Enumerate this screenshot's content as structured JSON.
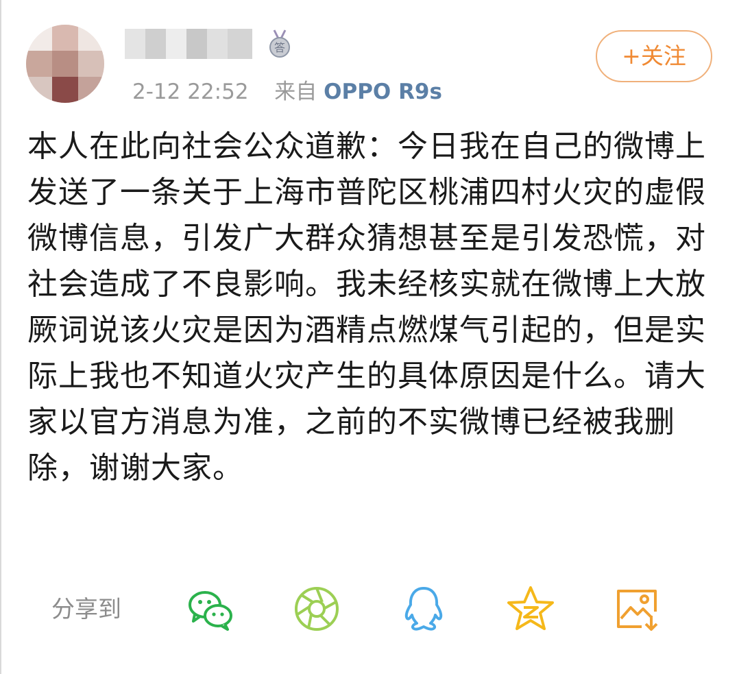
{
  "post": {
    "timestamp": "2-12 22:52",
    "source_prefix": "来自",
    "device": "OPPO R9s",
    "follow_label": "+关注",
    "body": "本人在此向社会公众道歉：今日我在自己的微博上发送了一条关于上海市普陀区桃浦四村火灾的虚假微博信息，引发广大群众猜想甚至是引发恐慌，对社会造成了不良影响。我未经核实就在微博上大放厥词说该火灾是因为酒精点燃煤气引起的，但是实际上我也不知道火灾产生的具体原因是什么。请大家以官方消息为准，之前的不实微博已经被我删除，谢谢大家。"
  },
  "share": {
    "label": "分享到",
    "targets": [
      {
        "icon": "wechat-icon",
        "color": "#2bb24c"
      },
      {
        "icon": "moments-icon",
        "color": "#9ccf54"
      },
      {
        "icon": "qq-icon",
        "color": "#4aa9e8"
      },
      {
        "icon": "qzone-icon",
        "color": "#f5b81a"
      },
      {
        "icon": "save-image-icon",
        "color": "#f0a030"
      }
    ]
  },
  "colors": {
    "accent_orange": "#f08a34",
    "device_blue": "#5b7fa6",
    "meta_gray": "#9a9a9a"
  }
}
